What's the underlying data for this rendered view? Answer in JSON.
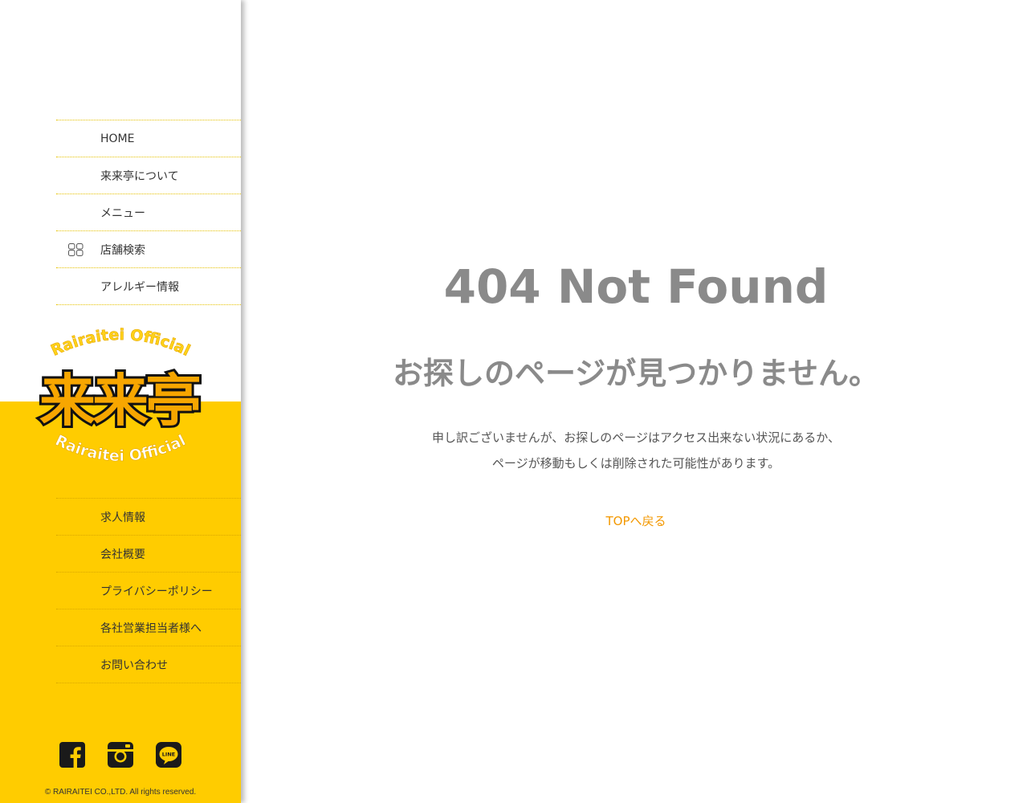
{
  "sidebar": {
    "nav_top": [
      {
        "label": "HOME"
      },
      {
        "label": "来来亭について"
      },
      {
        "label": "メニュー"
      },
      {
        "label": "店舗検索",
        "icon": "store-search-icon"
      },
      {
        "label": "アレルギー情報"
      }
    ],
    "logo": {
      "top_text": "Rairaitei Official",
      "main_text": "来来亭",
      "bottom_text": "Rairaitei Official"
    },
    "nav_bottom": [
      {
        "label": "求人情報"
      },
      {
        "label": "会社概要"
      },
      {
        "label": "プライバシーポリシー"
      },
      {
        "label": "各社営業担当者様へ"
      },
      {
        "label": "お問い合わせ"
      }
    ],
    "social": {
      "line_text": "LINE"
    },
    "copyright": "© RAIRAITEI CO.,LTD. All rights reserved."
  },
  "main": {
    "title": "404 Not Found",
    "subtitle": "お探しのページが見つかりません。",
    "message_line1": "申し訳ございませんが、お探しのページはアクセス出来ない状況にあるか、",
    "message_line2": "ページが移動もしくは削除された可能性があります。",
    "top_link": "TOPへ戻る"
  },
  "colors": {
    "brand_yellow": "#ffcc00",
    "logo_orange": "#f7a600",
    "link_orange": "#f39800",
    "title_gray": "#8a8a8a"
  }
}
